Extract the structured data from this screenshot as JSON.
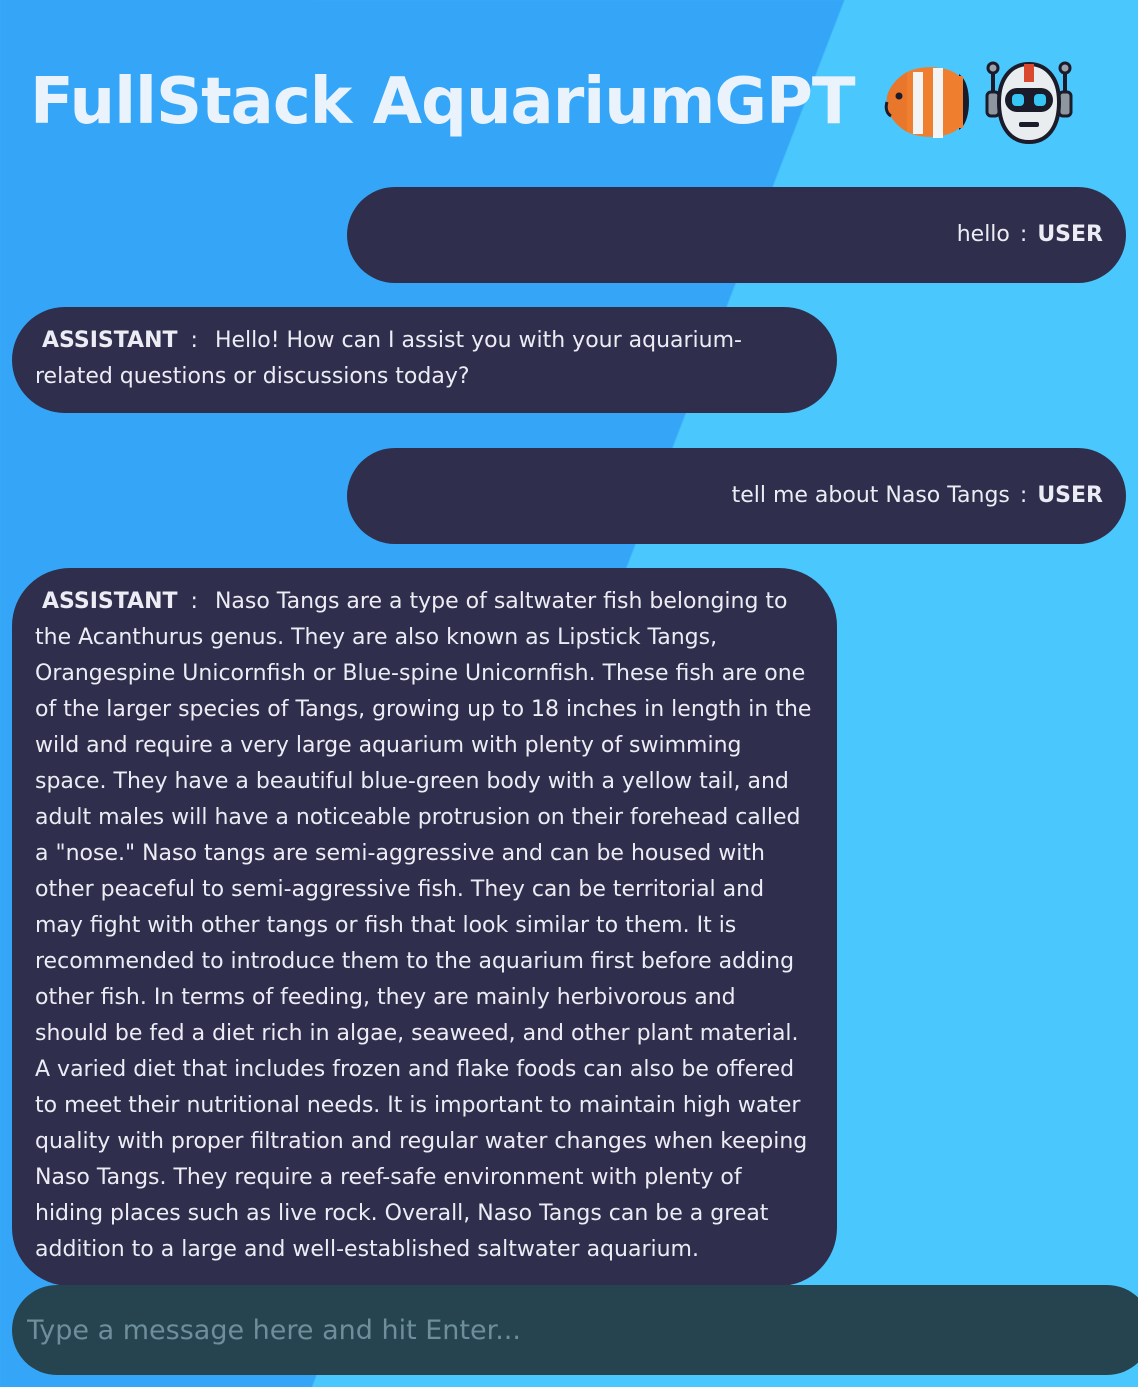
{
  "header": {
    "title": "FullStack AquariumGPT",
    "icons": [
      "fish-icon",
      "robot-icon"
    ]
  },
  "messages": [
    {
      "role": "USER",
      "text": "hello"
    },
    {
      "role": "ASSISTANT",
      "text": "Hello! How can I assist you with your aquarium-related questions or discussions today?"
    },
    {
      "role": "USER",
      "text": "tell me about Naso Tangs"
    },
    {
      "role": "ASSISTANT",
      "text": "Naso Tangs are a type of saltwater fish belonging to the Acanthurus genus. They are also known as Lipstick Tangs, Orangespine Unicornfish or Blue-spine Unicornfish. These fish are one of the larger species of Tangs, growing up to 18 inches in length in the wild and require a very large aquarium with plenty of swimming space. They have a beautiful blue-green body with a yellow tail, and adult males will have a noticeable protrusion on their forehead called a \"nose.\" Naso tangs are semi-aggressive and can be housed with other peaceful to semi-aggressive fish. They can be territorial and may fight with other tangs or fish that look similar to them. It is recommended to introduce them to the aquarium first before adding other fish. In terms of feeding, they are mainly herbivorous and should be fed a diet rich in algae, seaweed, and other plant material. A varied diet that includes frozen and flake foods can also be offered to meet their nutritional needs. It is important to maintain high water quality with proper filtration and regular water changes when keeping Naso Tangs. They require a reef-safe environment with plenty of hiding places such as live rock. Overall, Naso Tangs can be a great addition to a large and well-established saltwater aquarium."
    }
  ],
  "separator": ":",
  "composer": {
    "placeholder": "Type a message here and hit Enter...",
    "value": ""
  },
  "colors": {
    "background_left": "#35a6f7",
    "background_right": "#4ac8fd",
    "bubble": "#2f2f4d",
    "composer": "#254450"
  }
}
